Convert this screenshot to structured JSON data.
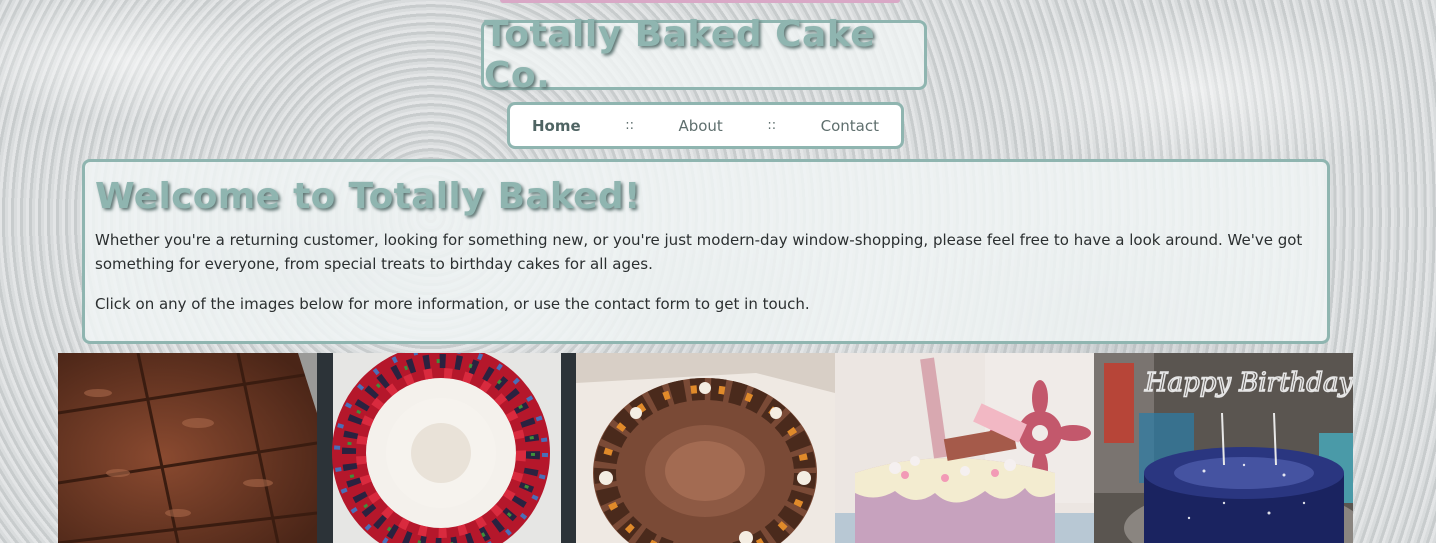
{
  "site": {
    "title": "Totally Baked Cake Co.",
    "accent_color": "#8fb5b0"
  },
  "nav": {
    "items": [
      {
        "label": "Home",
        "active": true
      },
      {
        "label": "About",
        "active": false
      },
      {
        "label": "Contact",
        "active": false
      }
    ],
    "separator": "::"
  },
  "welcome": {
    "heading": "Welcome to Totally Baked!",
    "paragraph1": "Whether you're a returning customer, looking for something new, or you're just modern-day window-shopping, please feel free to have a look around. We've got something for everyone, from special treats to birthday cakes for all ages.",
    "paragraph2": "Click on any of the images below for more information, or use the contact form to get in touch."
  },
  "gallery": {
    "items": [
      {
        "subject": "brownies"
      },
      {
        "subject": "berry-wreath-pavlova"
      },
      {
        "subject": "chocolate-cake"
      },
      {
        "subject": "pink-drip-cake"
      },
      {
        "subject": "galaxy-birthday-cake"
      }
    ],
    "topper_text": "Happy Birthday"
  }
}
